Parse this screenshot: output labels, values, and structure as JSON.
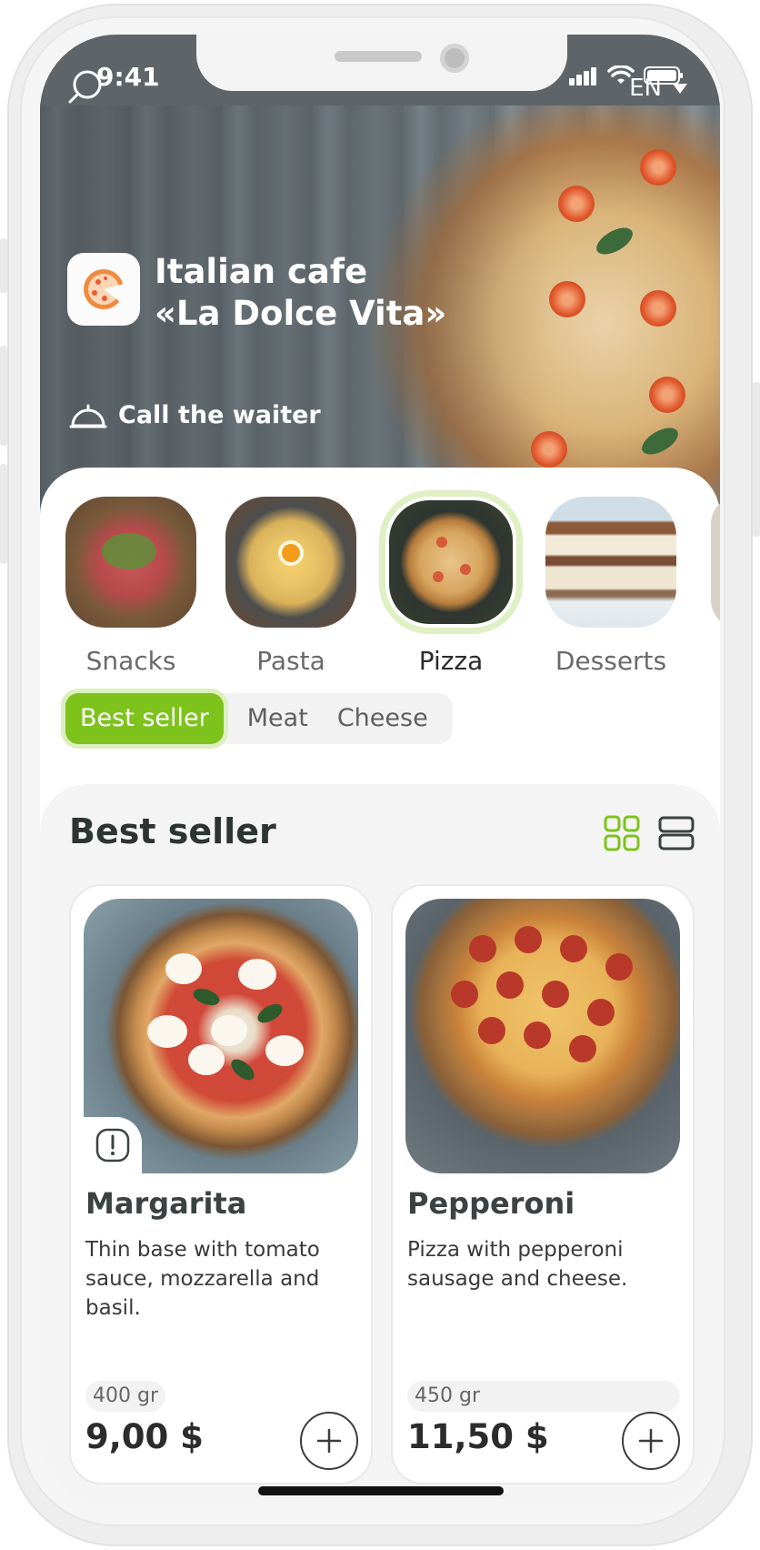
{
  "status_bar": {
    "time": "9:41"
  },
  "header": {
    "language": "EN",
    "cafe_name_line1": "Italian cafe",
    "cafe_name_line2": "«La Dolce Vita»",
    "call_waiter": "Call the waiter"
  },
  "categories": [
    {
      "label": "Snacks",
      "active": false
    },
    {
      "label": "Pasta",
      "active": false
    },
    {
      "label": "Pizza",
      "active": true
    },
    {
      "label": "Desserts",
      "active": false
    }
  ],
  "filters": [
    {
      "label": "Best seller",
      "active": true
    },
    {
      "label": "Meat",
      "active": false
    },
    {
      "label": "Cheese",
      "active": false
    }
  ],
  "section": {
    "title": "Best seller"
  },
  "products": [
    {
      "name": "Margarita",
      "description": "Thin base with tomato sauce, mozzarella and basil.",
      "weight": "400 gr",
      "price": "9,00 $"
    },
    {
      "name": "Pepperoni",
      "description": "Pizza with pepperoni sausage and cheese.",
      "weight": "450 gr",
      "price": "11,50 $"
    }
  ],
  "colors": {
    "accent": "#7ec31c",
    "accent_light": "#dcefbe",
    "status_bar": "#5e6468",
    "text_dark": "#2d3432"
  }
}
